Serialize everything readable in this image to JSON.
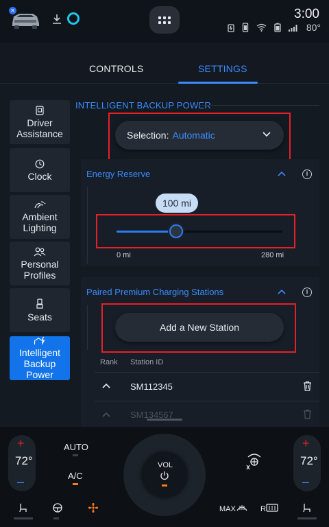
{
  "status": {
    "time": "3:00",
    "outside_temp": "80°"
  },
  "tabs": [
    {
      "label": "CONTROLS",
      "active": false
    },
    {
      "label": "SETTINGS",
      "active": true
    }
  ],
  "sidebar": {
    "items": [
      {
        "label": "Driver Assistance",
        "icon": "driver-assist-icon",
        "active": false
      },
      {
        "label": "Clock",
        "icon": "clock-icon",
        "active": false
      },
      {
        "label": "Ambient Lighting",
        "icon": "ambient-light-icon",
        "active": false
      },
      {
        "label": "Personal Profiles",
        "icon": "profiles-icon",
        "active": false
      },
      {
        "label": "Seats",
        "icon": "seat-icon",
        "active": false
      },
      {
        "label": "Intelligent Backup Power",
        "icon": "backup-power-icon",
        "active": true
      }
    ]
  },
  "main": {
    "section_title": "INTELLIGENT BACKUP POWER",
    "selection": {
      "label": "Selection:",
      "value": "Automatic"
    },
    "energy_reserve": {
      "title": "Energy Reserve",
      "bubble": "100 mi",
      "min_label": "0 mi",
      "max_label": "280 mi",
      "value_fraction": 0.36
    },
    "paired_stations": {
      "title": "Paired Premium Charging Stations",
      "add_button": "Add a New Station",
      "columns": [
        "Rank",
        "Station ID"
      ],
      "rows": [
        "SM112345",
        "SM134567"
      ]
    }
  },
  "climate": {
    "left_temp": "72°",
    "right_temp": "72°",
    "plus": "+",
    "minus": "–",
    "auto": "AUTO",
    "ac": "A/C",
    "vol": "VOL",
    "max_label": "MAX",
    "rear_label": "R"
  },
  "colors": {
    "accent": "#3b8cff",
    "active_tile": "#1273ea",
    "highlight_box": "#e6202a",
    "heat": "#e6202a",
    "cool": "#3b8cff",
    "indicator_on": "#ff7a1a"
  }
}
